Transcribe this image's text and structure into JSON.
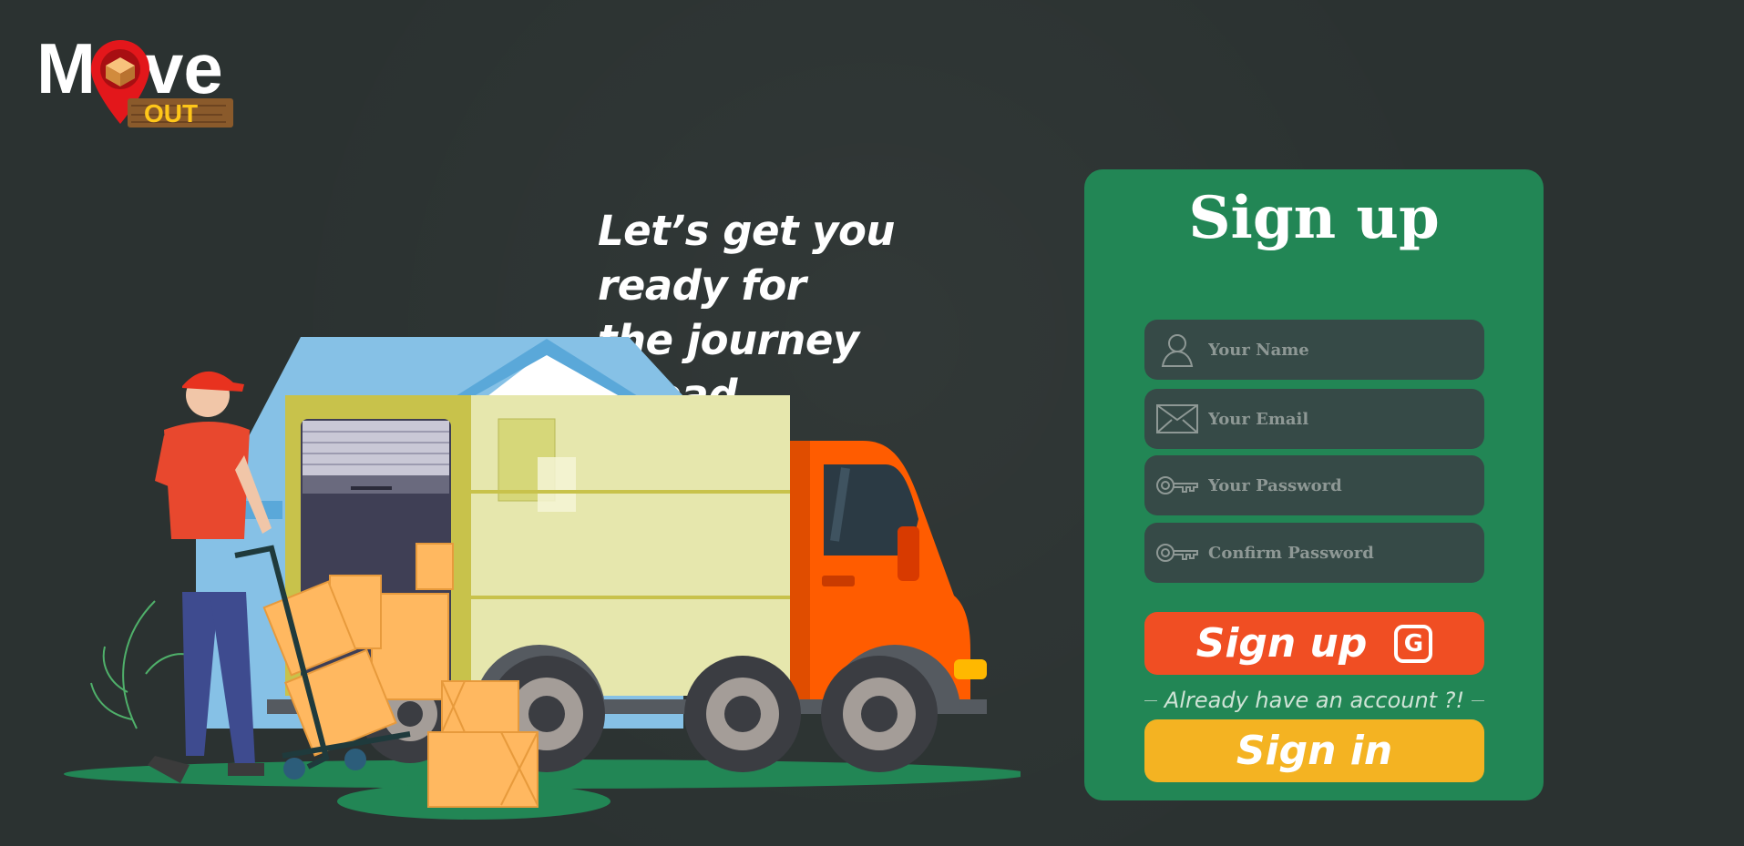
{
  "brand": {
    "logo_word_1": "M",
    "logo_word_2": "ve",
    "logo_sub": "OUT"
  },
  "hero": {
    "tagline_line1": "Let’s get you ready for",
    "tagline_line2": "the journey ahead..."
  },
  "signup": {
    "title": "Sign up",
    "fields": [
      {
        "placeholder": "Your Name",
        "icon": "user-icon"
      },
      {
        "placeholder": "Your Email",
        "icon": "envelope-icon"
      },
      {
        "placeholder": "Your Password",
        "icon": "key-icon"
      },
      {
        "placeholder": "Confirm Password",
        "icon": "key-icon"
      }
    ],
    "signup_button": "Sign up",
    "google_glyph": "G",
    "divider_text": "Already have an account ?!",
    "signin_button": "Sign in"
  },
  "colors": {
    "background": "#2b3231",
    "panel": "#228655",
    "field": "#364a47",
    "signup_button": "#f04e23",
    "signin_button": "#f4b322",
    "truck_orange": "#ff5c00",
    "box": "#ffb860"
  }
}
